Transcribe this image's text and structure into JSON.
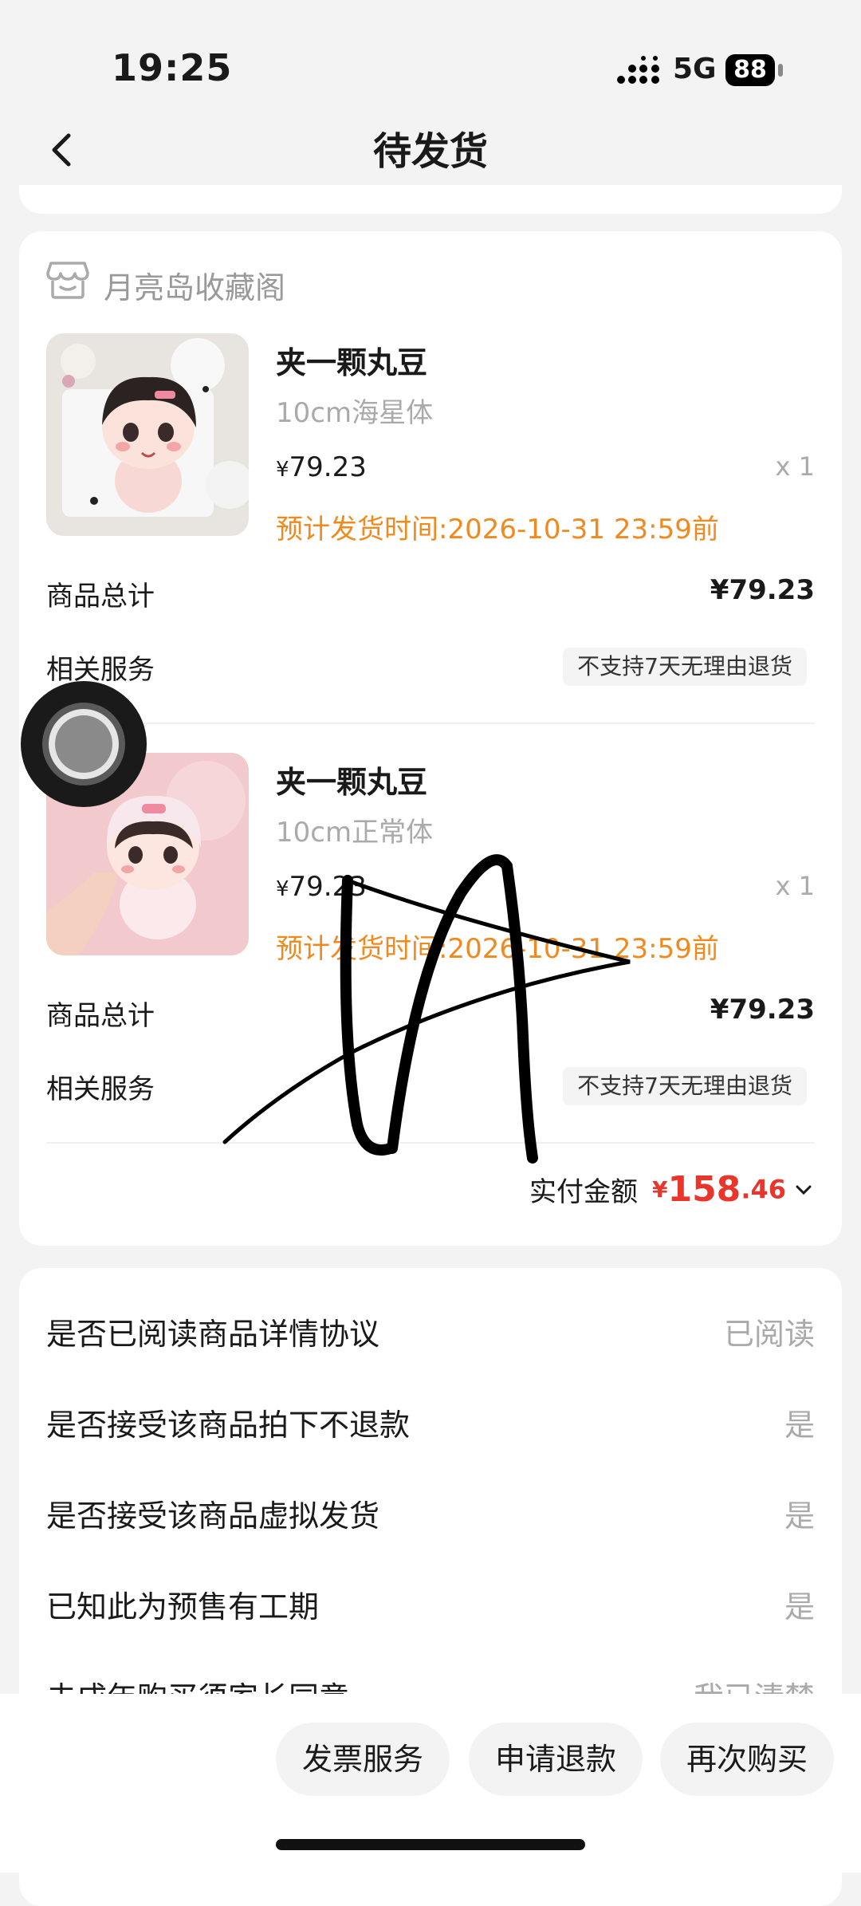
{
  "status_bar": {
    "time": "19:25",
    "network": "5G",
    "battery": "88"
  },
  "nav": {
    "title": "待发货",
    "back_icon": "chevron-left-icon"
  },
  "order": {
    "shop_name": "月亮岛收藏阁",
    "shop_icon": "store-icon",
    "items": [
      {
        "title": "夹一颗丸豆",
        "spec": "10cm海星体",
        "currency": "¥",
        "price": "79.23",
        "qty": "x 1",
        "ship_time": "预计发货时间:2026-10-31 23:59前",
        "subtotal_label": "商品总计",
        "subtotal": "¥79.23",
        "service_label": "相关服务",
        "service_tag": "不支持7天无理由退货"
      },
      {
        "title": "夹一颗丸豆",
        "spec": "10cm正常体",
        "currency": "¥",
        "price": "79.23",
        "qty": "x 1",
        "ship_time": "预计发货时间:2026-10-31 23:59前",
        "subtotal_label": "商品总计",
        "subtotal": "¥79.23",
        "service_label": "相关服务",
        "service_tag": "不支持7天无理由退货"
      }
    ],
    "paid": {
      "label": "实付金额",
      "currency": "¥",
      "integer": "158",
      "decimal": ".46"
    }
  },
  "agreements": [
    {
      "label": "是否已阅读商品详情协议",
      "value": "已阅读"
    },
    {
      "label": "是否接受该商品拍下不退款",
      "value": "是"
    },
    {
      "label": "是否接受该商品虚拟发货",
      "value": "是"
    },
    {
      "label": "已知此为预售有工期",
      "value": "是"
    },
    {
      "label": "未成年购买须家长同意",
      "value": "我已清楚"
    }
  ],
  "actions": [
    "发票服务",
    "申请退款",
    "再次购买"
  ],
  "colors": {
    "accent_orange": "#f08a1e",
    "price_red": "#e8362d",
    "background": "#f3f3f3"
  }
}
